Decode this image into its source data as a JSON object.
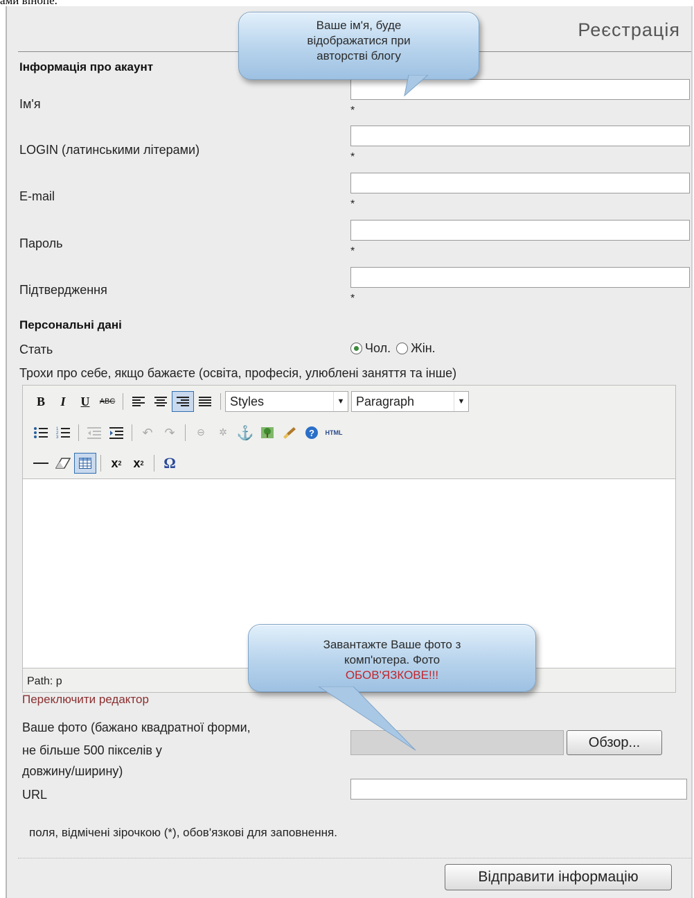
{
  "top_text": "ами вінопе.",
  "form": {
    "title": "Реєстрація",
    "account_section": "Інформація про акаунт",
    "fields": [
      {
        "label": "Ім'я",
        "required_mark": "*"
      },
      {
        "label": "LOGIN (латинськими літерами)",
        "required_mark": "*"
      },
      {
        "label": "E-mail",
        "required_mark": "*"
      },
      {
        "label": "Пароль",
        "required_mark": "*"
      },
      {
        "label": "Підтвердження",
        "required_mark": "*"
      }
    ],
    "personal_section": "Персональні дані",
    "gender": {
      "label": "Стать",
      "male": "Чол.",
      "female": "Жін.",
      "selected": "Чол."
    },
    "about_label": "Трохи про себе, якщо бажаєте (освіта, професія, улюблені заняття та інше)",
    "editor": {
      "styles_select": "Styles",
      "format_select": "Paragraph",
      "path": "Path: p",
      "toggle_link": "Переключити редактор",
      "icons": [
        "bold-icon",
        "italic-icon",
        "underline-icon",
        "strikethrough-icon",
        "align-left-icon",
        "align-center-icon",
        "align-right-icon",
        "align-justify-icon",
        "bullet-list-icon",
        "numbered-list-icon",
        "outdent-icon",
        "indent-icon",
        "undo-icon",
        "redo-icon",
        "link-icon",
        "unlink-icon",
        "anchor-icon",
        "image-icon",
        "cleanup-icon",
        "help-icon",
        "html-icon",
        "horizontal-rule-icon",
        "remove-format-icon",
        "table-icon",
        "subscript-icon",
        "superscript-icon",
        "special-char-icon"
      ]
    },
    "photo": {
      "label_line1": "Ваше фото (бажано квадратної форми,",
      "label_line2": "не більше 500 пікселів у",
      "label_line3": "довжину/ширину)",
      "browse_button": "Обзор..."
    },
    "url_label": "URL",
    "required_note": "поля, відмічені зірочкою (*), обов'язкові для заповнення.",
    "submit_button": "Відправити інформацію"
  },
  "callouts": {
    "name_hint": {
      "line1": "Ваше ім'я, буде",
      "line2": "відображатися при",
      "line3": "авторстві блогу"
    },
    "photo_hint": {
      "line1": "Завантажте Ваше фото з",
      "line2": "комп'ютера. Фото",
      "line3": "ОБОВ'ЯЗКОВЕ!!!"
    }
  },
  "colors": {
    "link": "#8b2e2e",
    "warning": "#c0262d",
    "callout": "#b7d3ec"
  }
}
